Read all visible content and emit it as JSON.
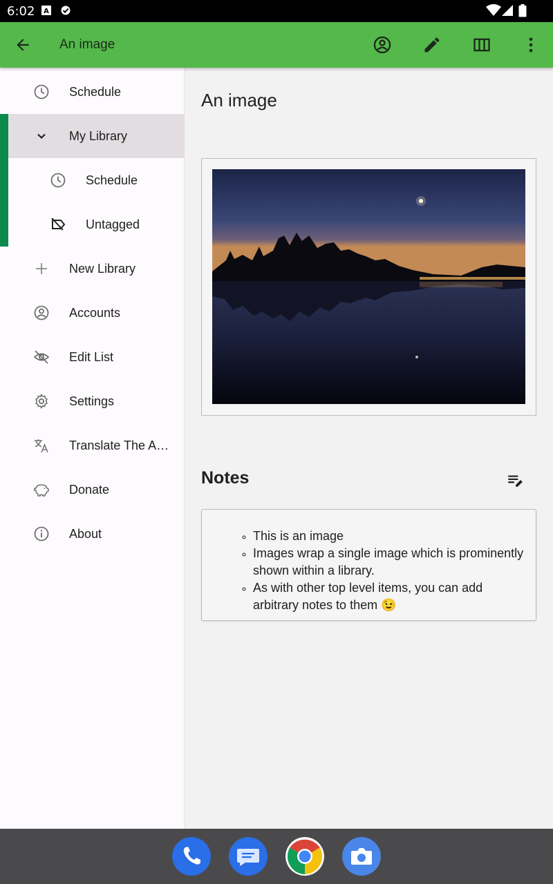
{
  "status_bar": {
    "time": "6:02",
    "notification_icons": [
      "a-box-icon",
      "check-badge-icon"
    ],
    "system_icons": [
      "wifi-icon",
      "cell-signal-icon",
      "battery-icon"
    ]
  },
  "app_bar": {
    "title": "An image",
    "actions": [
      "account-icon",
      "edit-icon",
      "columns-icon",
      "more-vert-icon"
    ]
  },
  "drawer": {
    "items": [
      {
        "label": "Schedule",
        "icon": "clock-icon"
      },
      {
        "label": "My Library",
        "icon": "chevron-down-icon",
        "selected": true
      },
      {
        "label": "Schedule",
        "icon": "clock-icon"
      },
      {
        "label": "Untagged",
        "icon": "tag-off-icon"
      },
      {
        "label": "New Library",
        "icon": "plus-icon"
      },
      {
        "label": "Accounts",
        "icon": "account-circle-icon"
      },
      {
        "label": "Edit List",
        "icon": "eye-off-icon"
      },
      {
        "label": "Settings",
        "icon": "gear-icon"
      },
      {
        "label": "Translate The A…",
        "icon": "translate-icon"
      },
      {
        "label": "Donate",
        "icon": "piggy-bank-icon"
      },
      {
        "label": "About",
        "icon": "info-icon"
      }
    ]
  },
  "main": {
    "title": "An image",
    "notes_heading": "Notes",
    "notes": [
      "This is an image",
      "Images wrap a single image which is prominently shown within a library.",
      "As with other top level items, you can add arbitrary notes to them 😉"
    ]
  },
  "dock": {
    "apps": [
      "phone-icon",
      "messages-icon",
      "chrome-icon",
      "camera-icon"
    ]
  },
  "colors": {
    "app_bar": "#55b84b",
    "library_accent": "#0b8a4b",
    "selected_row": "#e2dde1"
  }
}
